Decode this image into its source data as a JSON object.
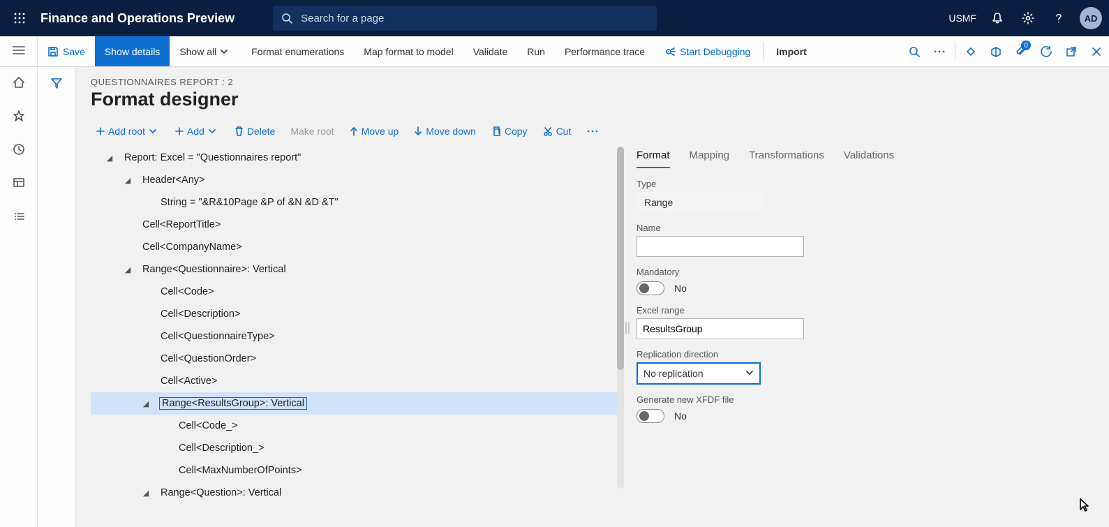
{
  "header": {
    "brand": "Finance and Operations Preview",
    "search_placeholder": "Search for a page",
    "company": "USMF",
    "avatar_initials": "AD"
  },
  "cmdbar": {
    "save": "Save",
    "show_details": "Show details",
    "show_all": "Show all",
    "format_enum": "Format enumerations",
    "map_format": "Map format to model",
    "validate": "Validate",
    "run": "Run",
    "perf_trace": "Performance trace",
    "start_debug": "Start Debugging",
    "import": "Import",
    "attach_count": "0"
  },
  "page": {
    "breadcrumb": "QUESTIONNAIRES REPORT : 2",
    "title": "Format designer"
  },
  "actions": {
    "add_root": "Add root",
    "add": "Add",
    "delete": "Delete",
    "make_root": "Make root",
    "move_up": "Move up",
    "move_down": "Move down",
    "copy": "Copy",
    "cut": "Cut"
  },
  "tree": [
    {
      "depth": 0,
      "expand": true,
      "sel": false,
      "label": "Report: Excel = \"Questionnaires report\""
    },
    {
      "depth": 1,
      "expand": true,
      "sel": false,
      "label": "Header<Any>"
    },
    {
      "depth": 2,
      "expand": null,
      "sel": false,
      "label": "String = \"&R&10Page &P of &N &D &T\""
    },
    {
      "depth": 1,
      "expand": null,
      "sel": false,
      "label": "Cell<ReportTitle>"
    },
    {
      "depth": 1,
      "expand": null,
      "sel": false,
      "label": "Cell<CompanyName>"
    },
    {
      "depth": 1,
      "expand": true,
      "sel": false,
      "label": "Range<Questionnaire>: Vertical"
    },
    {
      "depth": 2,
      "expand": null,
      "sel": false,
      "label": "Cell<Code>"
    },
    {
      "depth": 2,
      "expand": null,
      "sel": false,
      "label": "Cell<Description>"
    },
    {
      "depth": 2,
      "expand": null,
      "sel": false,
      "label": "Cell<QuestionnaireType>"
    },
    {
      "depth": 2,
      "expand": null,
      "sel": false,
      "label": "Cell<QuestionOrder>"
    },
    {
      "depth": 2,
      "expand": null,
      "sel": false,
      "label": "Cell<Active>"
    },
    {
      "depth": 2,
      "expand": true,
      "sel": true,
      "label": "Range<ResultsGroup>: Vertical"
    },
    {
      "depth": 3,
      "expand": null,
      "sel": false,
      "label": "Cell<Code_>"
    },
    {
      "depth": 3,
      "expand": null,
      "sel": false,
      "label": "Cell<Description_>"
    },
    {
      "depth": 3,
      "expand": null,
      "sel": false,
      "label": "Cell<MaxNumberOfPoints>"
    },
    {
      "depth": 2,
      "expand": true,
      "sel": false,
      "label": "Range<Question>: Vertical"
    }
  ],
  "tabs": {
    "format": "Format",
    "mapping": "Mapping",
    "transformations": "Transformations",
    "validations": "Validations"
  },
  "details": {
    "type_label": "Type",
    "type_value": "Range",
    "name_label": "Name",
    "name_value": "",
    "mandatory_label": "Mandatory",
    "mandatory_value": "No",
    "excel_range_label": "Excel range",
    "excel_range_value": "ResultsGroup",
    "replication_label": "Replication direction",
    "replication_value": "No replication",
    "xfdf_label": "Generate new XFDF file",
    "xfdf_value": "No"
  }
}
